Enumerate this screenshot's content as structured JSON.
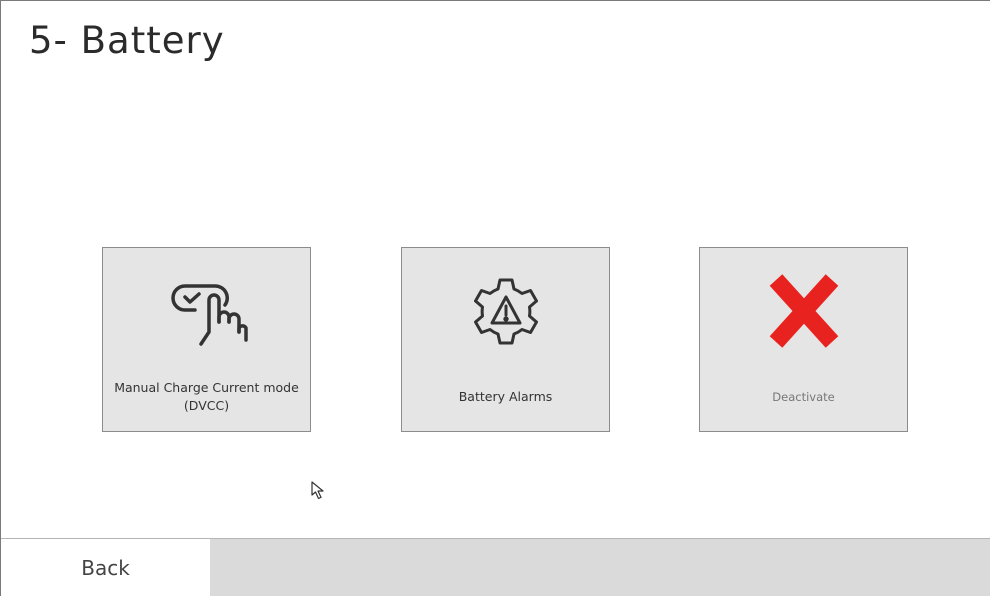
{
  "header": {
    "title": "5- Battery"
  },
  "tiles": [
    {
      "label": "Manual Charge Current mode (DVCC)",
      "icon": "touch-checkbox-icon"
    },
    {
      "label": "Battery Alarms",
      "icon": "gear-warning-icon"
    },
    {
      "label": "Deactivate",
      "icon": "red-x-icon"
    }
  ],
  "footer": {
    "back_label": "Back"
  },
  "colors": {
    "tile_bg": "#e5e5e5",
    "deactivate_x": "#e8231f",
    "footer_bg": "#dadada",
    "icon_stroke": "#333333"
  }
}
